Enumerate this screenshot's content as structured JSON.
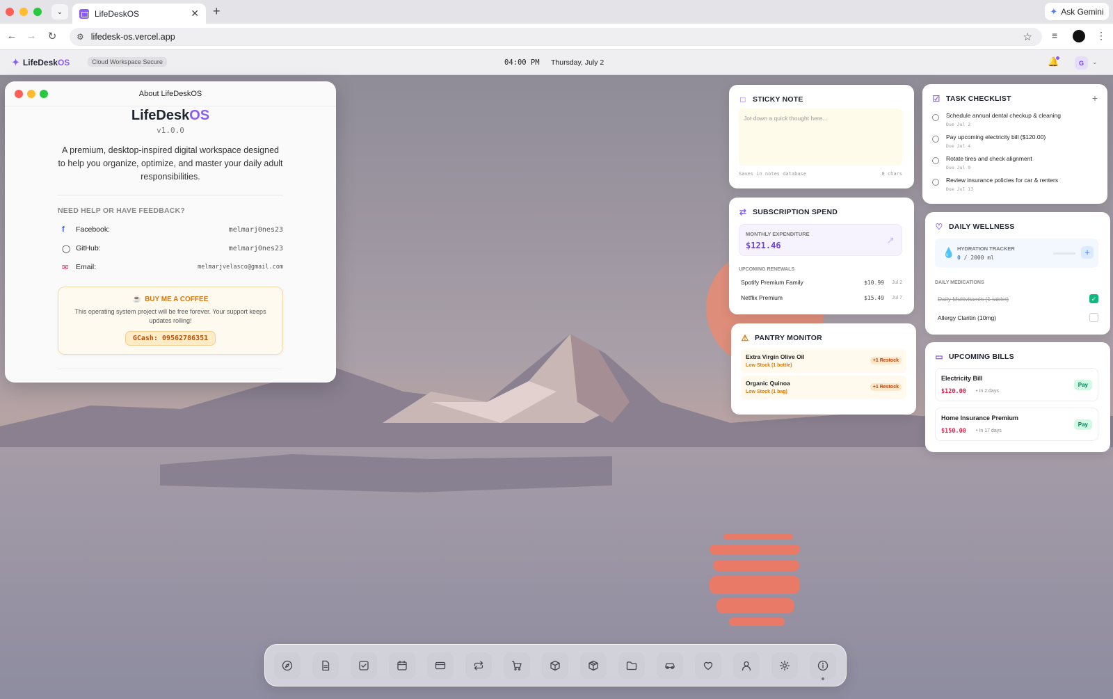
{
  "browser": {
    "tab_title": "LifeDeskOS",
    "url": "lifedesk-os.vercel.app",
    "ask_gemini": "Ask Gemini"
  },
  "osbar": {
    "brand_prefix": "LifeDesk",
    "brand_suffix": "OS",
    "badge": "Cloud Workspace Secure",
    "time": "04:00 PM",
    "date": "Thursday, July 2",
    "avatar_initial": "G"
  },
  "about": {
    "window_title": "About LifeDeskOS",
    "app_prefix": "LifeDesk",
    "app_suffix": "OS",
    "version": "v1.0.0",
    "description": "A premium, desktop-inspired digital workspace designed to help you organize, optimize, and master your daily adult responsibilities.",
    "help_heading": "NEED HELP OR HAVE FEEDBACK?",
    "contacts": [
      {
        "label": "Facebook:",
        "value": "melmarj0nes23",
        "icon": "facebook-icon"
      },
      {
        "label": "GitHub:",
        "value": "melmarj0nes23",
        "icon": "github-icon"
      },
      {
        "label": "Email:",
        "value": "melmarjvelasco@gmail.com",
        "icon": "mail-icon"
      }
    ],
    "coffee": {
      "heading": "BUY ME A COFFEE",
      "text": "This operating system project will be free forever. Your support keeps updates rolling!",
      "gcash": "GCash: 09562786351"
    }
  },
  "sticky": {
    "title": "STICKY NOTE",
    "placeholder": "Jot down a quick thought here...",
    "saves_note": "Saves in notes database",
    "char_count": "0 chars"
  },
  "subscription": {
    "title": "SUBSCRIPTION SPEND",
    "monthly_label": "MONTHLY EXPENDITURE",
    "monthly_value": "$121.46",
    "renewals_heading": "UPCOMING RENEWALS",
    "renewals": [
      {
        "name": "Spotify Premium Family",
        "price": "$10.99",
        "date": "Jul 2"
      },
      {
        "name": "Netflix Premium",
        "price": "$15.49",
        "date": "Jul 7"
      }
    ]
  },
  "pantry": {
    "title": "PANTRY MONITOR",
    "items": [
      {
        "name": "Extra Virgin Olive Oil",
        "status": "Low Stock (1 bottle)",
        "action": "+1 Restock"
      },
      {
        "name": "Organic Quinoa",
        "status": "Low Stock (1 bag)",
        "action": "+1 Restock"
      }
    ]
  },
  "tasks": {
    "title": "TASK CHECKLIST",
    "add": "+",
    "items": [
      {
        "title": "Schedule annual dental checkup & cleaning",
        "due": "Due Jul 2"
      },
      {
        "title": "Pay upcoming electricity bill ($120.00)",
        "due": "Due Jul 4"
      },
      {
        "title": "Rotate tires and check alignment",
        "due": "Due Jul 9"
      },
      {
        "title": "Review insurance policies for car & renters",
        "due": "Due Jul 13"
      }
    ]
  },
  "wellness": {
    "title": "DAILY WELLNESS",
    "hydration_label": "HYDRATION TRACKER",
    "hydration_current": "0",
    "hydration_goal": " / 2000 ml",
    "hydration_fraction": 0.0,
    "meds_heading": "DAILY MEDICATIONS",
    "meds": [
      {
        "name": "Daily Multivitamin (1 tablet)",
        "taken": true
      },
      {
        "name": "Allergy Claritin (10mg)",
        "taken": false
      }
    ]
  },
  "bills": {
    "title": "UPCOMING BILLS",
    "items": [
      {
        "name": "Electricity Bill",
        "amount": "$120.00",
        "due": "In 2 days",
        "action": "Pay"
      },
      {
        "name": "Home Insurance Premium",
        "amount": "$150.00",
        "due": "In 17 days",
        "action": "Pay"
      }
    ]
  },
  "dock": {
    "items": [
      "compass-icon",
      "document-icon",
      "checklist-icon",
      "calendar-icon",
      "credit-card-icon",
      "repeat-icon",
      "cart-icon",
      "box-icon",
      "package-icon",
      "folder-icon",
      "car-icon",
      "heart-icon",
      "user-icon",
      "settings-icon",
      "info-icon"
    ]
  },
  "colors": {
    "accent": "#8a5cf6",
    "warning": "#d97706",
    "danger": "#e11d48",
    "success": "#10b981"
  }
}
